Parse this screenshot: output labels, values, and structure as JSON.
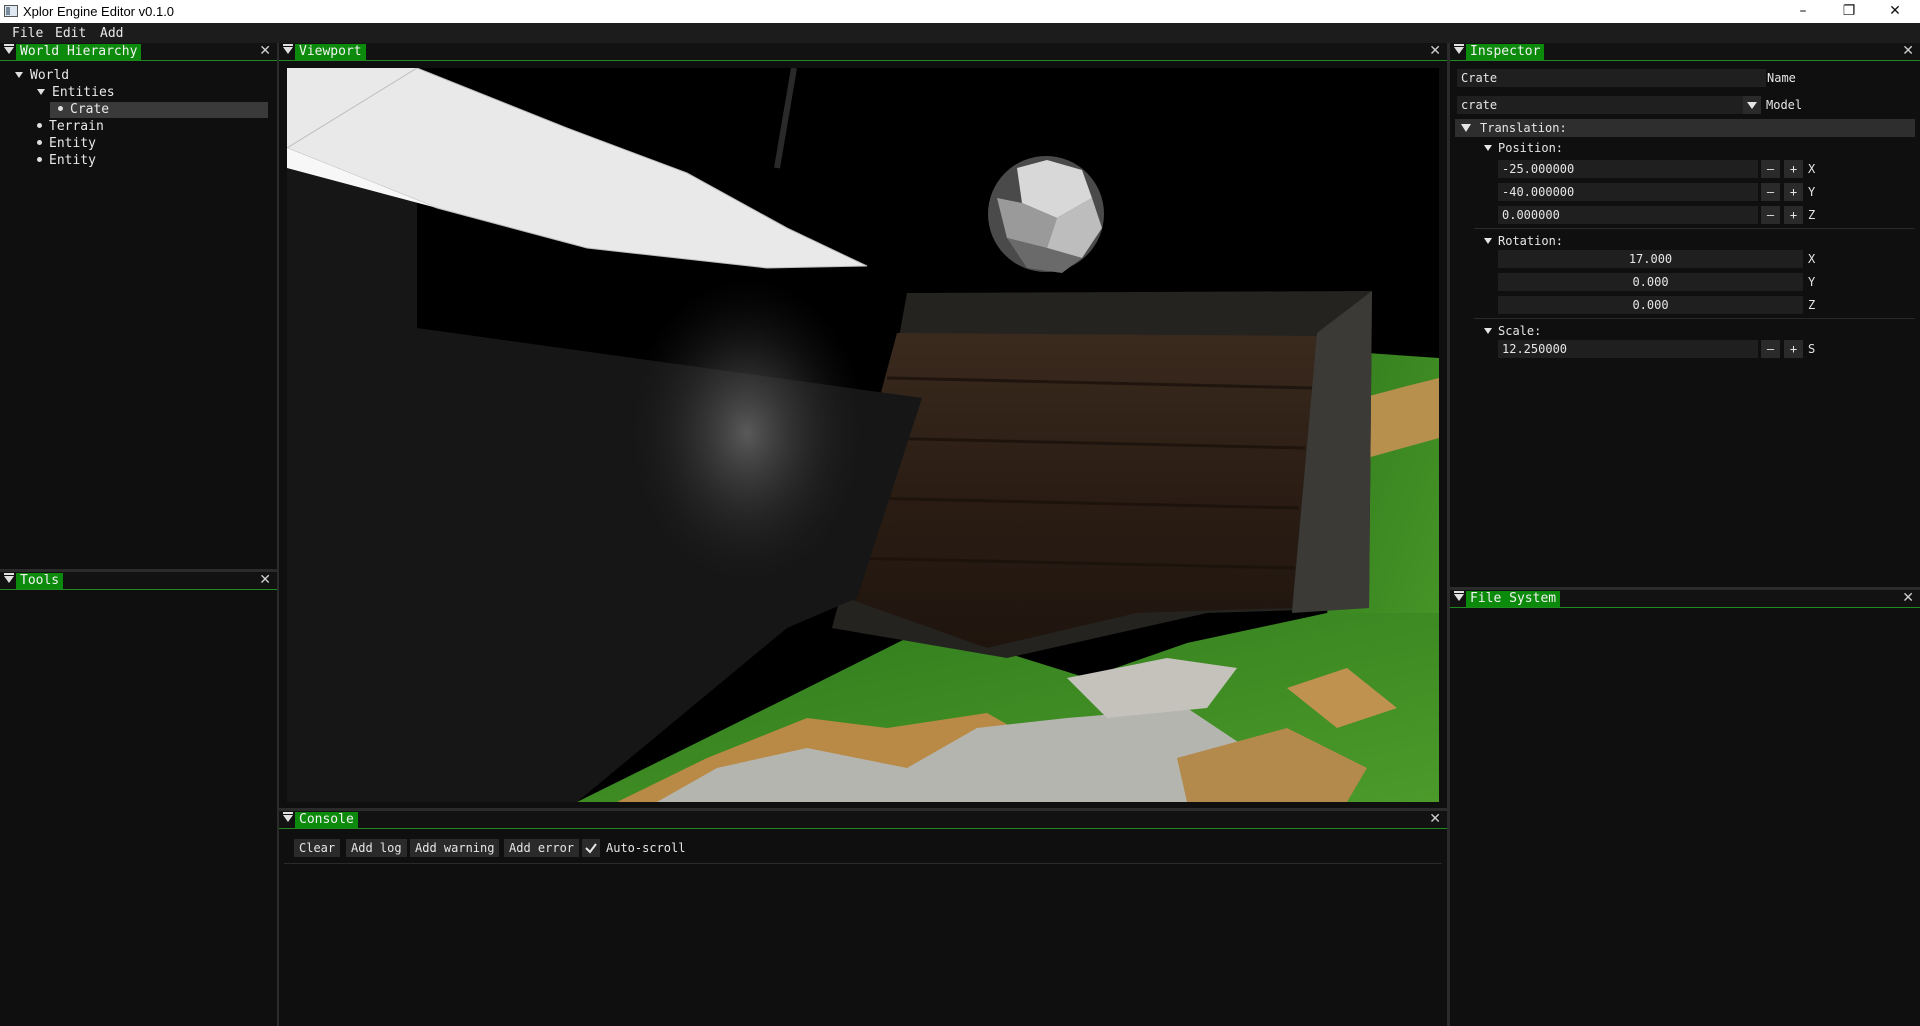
{
  "window": {
    "title": "Xplor Engine Editor v0.1.0",
    "minimize": "–",
    "restore": "❐",
    "close": "✕"
  },
  "menu": [
    "File",
    "Edit",
    "Add"
  ],
  "hierarchy": {
    "title": "World Hierarchy",
    "items": [
      {
        "label": "World",
        "icon": "triangle-expanded"
      },
      {
        "label": "Entities",
        "icon": "triangle-expanded"
      },
      {
        "label": "Crate",
        "icon": "bullet",
        "selected": true
      },
      {
        "label": "Terrain",
        "icon": "bullet"
      },
      {
        "label": "Entity",
        "icon": "bullet"
      },
      {
        "label": "Entity",
        "icon": "bullet"
      }
    ]
  },
  "tools": {
    "title": "Tools"
  },
  "viewport": {
    "title": "Viewport"
  },
  "console": {
    "title": "Console",
    "buttons": {
      "clear": "Clear",
      "add_log": "Add log",
      "add_warning": "Add warning",
      "add_error": "Add error"
    },
    "autoscroll_label": "Auto-scroll",
    "autoscroll_checked": true
  },
  "inspector": {
    "title": "Inspector",
    "name_value": "Crate",
    "name_label": "Name",
    "model_value": "crate",
    "model_label": "Model",
    "translation_label": "Translation:",
    "position": {
      "label": "Position:",
      "x": "-25.000000",
      "y": "-40.000000",
      "z": "0.000000",
      "x_axis": "X",
      "y_axis": "Y",
      "z_axis": "Z"
    },
    "rotation": {
      "label": "Rotation:",
      "x": "17.000",
      "y": "0.000",
      "z": "0.000",
      "x_axis": "X",
      "y_axis": "Y",
      "z_axis": "Z"
    },
    "scale": {
      "label": "Scale:",
      "s": "12.250000",
      "s_axis": "S"
    },
    "minus": "–",
    "plus": "+"
  },
  "filesystem": {
    "title": "File System"
  },
  "colors": {
    "accent_green": "#0c8a0c",
    "panel_bg": "#0f0f0f",
    "field_bg": "#1f1f1f"
  }
}
